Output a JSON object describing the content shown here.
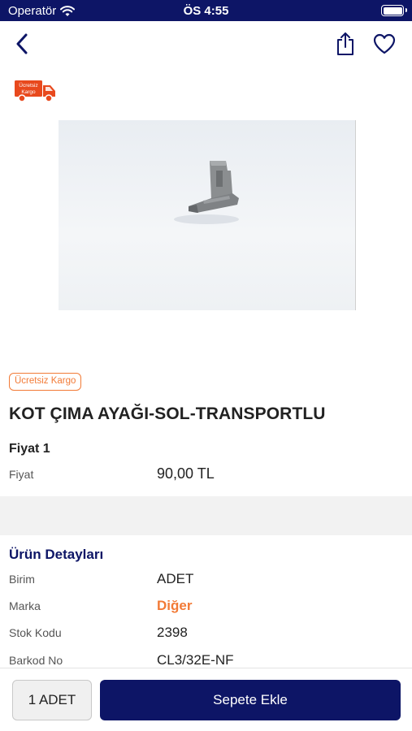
{
  "status_bar": {
    "carrier": "Operatör",
    "time": "ÖS 4:55"
  },
  "nav": {
    "back_icon": "chevron-left-icon",
    "share_icon": "share-icon",
    "favorite_icon": "heart-icon"
  },
  "badge_truck": {
    "line1": "Ücretsiz",
    "line2": "Kargo"
  },
  "product": {
    "free_shipping_badge": "Ücretsiz Kargo",
    "title": "KOT ÇIMA AYAĞI-SOL-TRANSPORTLU",
    "price_section": {
      "heading": "Fiyat 1",
      "label": "Fiyat",
      "value": "90,00 TL"
    }
  },
  "details": {
    "heading": "Ürün Detayları",
    "rows": [
      {
        "label": "Birim",
        "value": "ADET"
      },
      {
        "label": "Marka",
        "value": "Diğer"
      },
      {
        "label": "Stok Kodu",
        "value": "2398"
      },
      {
        "label": "Barkod No",
        "value": "CL3/32E-NF"
      }
    ]
  },
  "bottom_bar": {
    "quantity_label": "1 ADET",
    "add_to_cart_label": "Sepete Ekle"
  },
  "colors": {
    "primary": "#0d1566",
    "accent": "#f27a36"
  }
}
